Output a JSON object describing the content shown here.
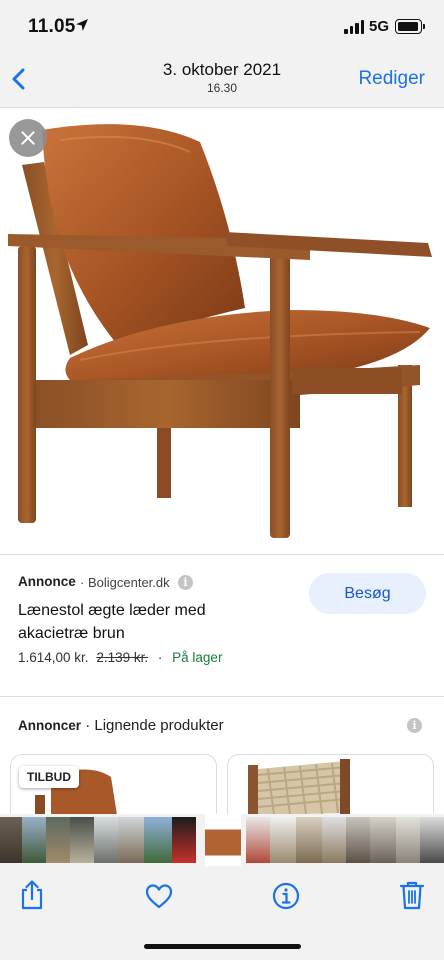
{
  "status_bar": {
    "time": "11.05",
    "network": "5G",
    "icons": [
      "location-arrow-icon",
      "signal-icon",
      "battery-icon"
    ]
  },
  "nav": {
    "title": "3. oktober 2021",
    "subtitle": "16.30",
    "edit_label": "Rediger",
    "back_icon": "chevron-left-icon"
  },
  "photo": {
    "alt": "leather armchair with acacia wood frame",
    "close_icon": "close-icon"
  },
  "ad": {
    "label": "Annonce",
    "source": "Boligcenter.dk",
    "title_line1": "Lænestol ægte læder med",
    "title_line2": "akacietræ brun",
    "price": "1.614,00 kr.",
    "old_price": "2.139 kr.",
    "separator": "·",
    "availability": "På lager",
    "visit_label": "Besøg"
  },
  "similar": {
    "label_bold": "Annoncer",
    "label_rest": "Lignende produkter",
    "badge": "TILBUD"
  },
  "toolbar": {
    "icons": [
      "share-icon",
      "heart-icon",
      "info-icon",
      "trash-icon"
    ]
  },
  "colors": {
    "accent": "#1a73e8",
    "stock_green": "#188038",
    "button_bg": "#e8f0fe",
    "bar_bg": "#f2f2f2"
  }
}
